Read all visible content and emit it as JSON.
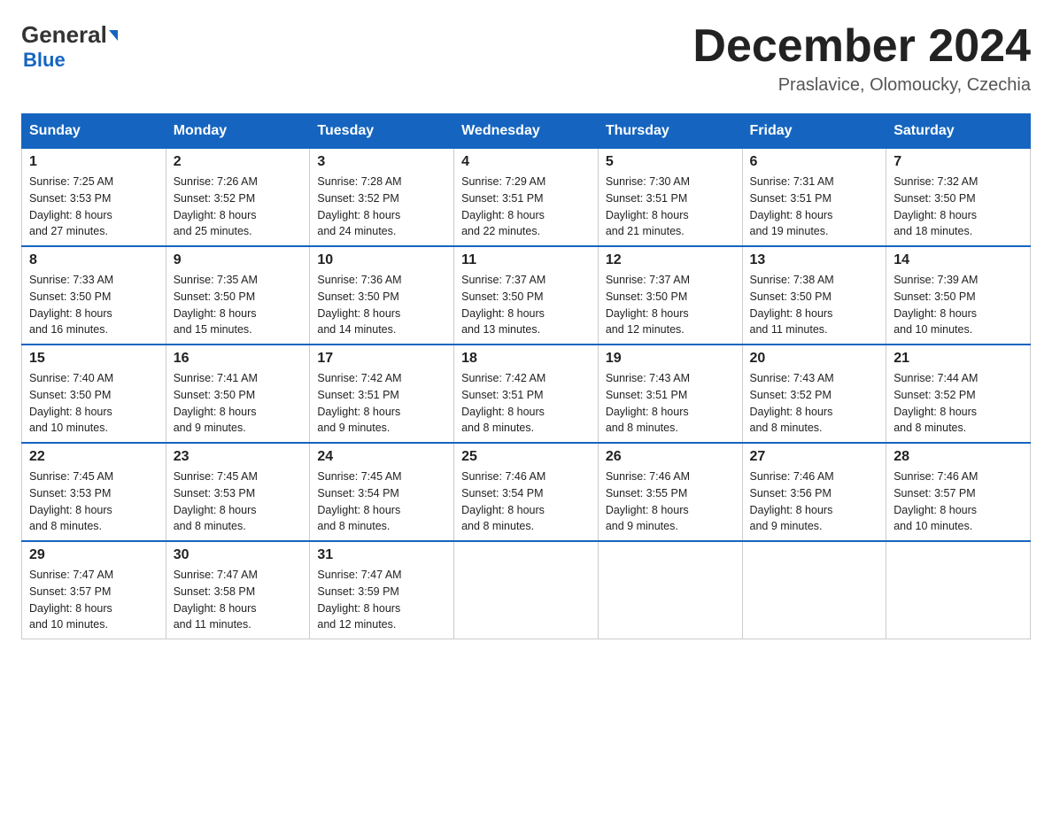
{
  "header": {
    "logo_line1": "General",
    "logo_line2": "Blue",
    "month_title": "December 2024",
    "location": "Praslavice, Olomoucky, Czechia"
  },
  "weekdays": [
    "Sunday",
    "Monday",
    "Tuesday",
    "Wednesday",
    "Thursday",
    "Friday",
    "Saturday"
  ],
  "weeks": [
    [
      {
        "day": "1",
        "sunrise": "7:25 AM",
        "sunset": "3:53 PM",
        "daylight": "8 hours and 27 minutes."
      },
      {
        "day": "2",
        "sunrise": "7:26 AM",
        "sunset": "3:52 PM",
        "daylight": "8 hours and 25 minutes."
      },
      {
        "day": "3",
        "sunrise": "7:28 AM",
        "sunset": "3:52 PM",
        "daylight": "8 hours and 24 minutes."
      },
      {
        "day": "4",
        "sunrise": "7:29 AM",
        "sunset": "3:51 PM",
        "daylight": "8 hours and 22 minutes."
      },
      {
        "day": "5",
        "sunrise": "7:30 AM",
        "sunset": "3:51 PM",
        "daylight": "8 hours and 21 minutes."
      },
      {
        "day": "6",
        "sunrise": "7:31 AM",
        "sunset": "3:51 PM",
        "daylight": "8 hours and 19 minutes."
      },
      {
        "day": "7",
        "sunrise": "7:32 AM",
        "sunset": "3:50 PM",
        "daylight": "8 hours and 18 minutes."
      }
    ],
    [
      {
        "day": "8",
        "sunrise": "7:33 AM",
        "sunset": "3:50 PM",
        "daylight": "8 hours and 16 minutes."
      },
      {
        "day": "9",
        "sunrise": "7:35 AM",
        "sunset": "3:50 PM",
        "daylight": "8 hours and 15 minutes."
      },
      {
        "day": "10",
        "sunrise": "7:36 AM",
        "sunset": "3:50 PM",
        "daylight": "8 hours and 14 minutes."
      },
      {
        "day": "11",
        "sunrise": "7:37 AM",
        "sunset": "3:50 PM",
        "daylight": "8 hours and 13 minutes."
      },
      {
        "day": "12",
        "sunrise": "7:37 AM",
        "sunset": "3:50 PM",
        "daylight": "8 hours and 12 minutes."
      },
      {
        "day": "13",
        "sunrise": "7:38 AM",
        "sunset": "3:50 PM",
        "daylight": "8 hours and 11 minutes."
      },
      {
        "day": "14",
        "sunrise": "7:39 AM",
        "sunset": "3:50 PM",
        "daylight": "8 hours and 10 minutes."
      }
    ],
    [
      {
        "day": "15",
        "sunrise": "7:40 AM",
        "sunset": "3:50 PM",
        "daylight": "8 hours and 10 minutes."
      },
      {
        "day": "16",
        "sunrise": "7:41 AM",
        "sunset": "3:50 PM",
        "daylight": "8 hours and 9 minutes."
      },
      {
        "day": "17",
        "sunrise": "7:42 AM",
        "sunset": "3:51 PM",
        "daylight": "8 hours and 9 minutes."
      },
      {
        "day": "18",
        "sunrise": "7:42 AM",
        "sunset": "3:51 PM",
        "daylight": "8 hours and 8 minutes."
      },
      {
        "day": "19",
        "sunrise": "7:43 AM",
        "sunset": "3:51 PM",
        "daylight": "8 hours and 8 minutes."
      },
      {
        "day": "20",
        "sunrise": "7:43 AM",
        "sunset": "3:52 PM",
        "daylight": "8 hours and 8 minutes."
      },
      {
        "day": "21",
        "sunrise": "7:44 AM",
        "sunset": "3:52 PM",
        "daylight": "8 hours and 8 minutes."
      }
    ],
    [
      {
        "day": "22",
        "sunrise": "7:45 AM",
        "sunset": "3:53 PM",
        "daylight": "8 hours and 8 minutes."
      },
      {
        "day": "23",
        "sunrise": "7:45 AM",
        "sunset": "3:53 PM",
        "daylight": "8 hours and 8 minutes."
      },
      {
        "day": "24",
        "sunrise": "7:45 AM",
        "sunset": "3:54 PM",
        "daylight": "8 hours and 8 minutes."
      },
      {
        "day": "25",
        "sunrise": "7:46 AM",
        "sunset": "3:54 PM",
        "daylight": "8 hours and 8 minutes."
      },
      {
        "day": "26",
        "sunrise": "7:46 AM",
        "sunset": "3:55 PM",
        "daylight": "8 hours and 9 minutes."
      },
      {
        "day": "27",
        "sunrise": "7:46 AM",
        "sunset": "3:56 PM",
        "daylight": "8 hours and 9 minutes."
      },
      {
        "day": "28",
        "sunrise": "7:46 AM",
        "sunset": "3:57 PM",
        "daylight": "8 hours and 10 minutes."
      }
    ],
    [
      {
        "day": "29",
        "sunrise": "7:47 AM",
        "sunset": "3:57 PM",
        "daylight": "8 hours and 10 minutes."
      },
      {
        "day": "30",
        "sunrise": "7:47 AM",
        "sunset": "3:58 PM",
        "daylight": "8 hours and 11 minutes."
      },
      {
        "day": "31",
        "sunrise": "7:47 AM",
        "sunset": "3:59 PM",
        "daylight": "8 hours and 12 minutes."
      },
      null,
      null,
      null,
      null
    ]
  ],
  "labels": {
    "sunrise": "Sunrise:",
    "sunset": "Sunset:",
    "daylight": "Daylight:"
  }
}
